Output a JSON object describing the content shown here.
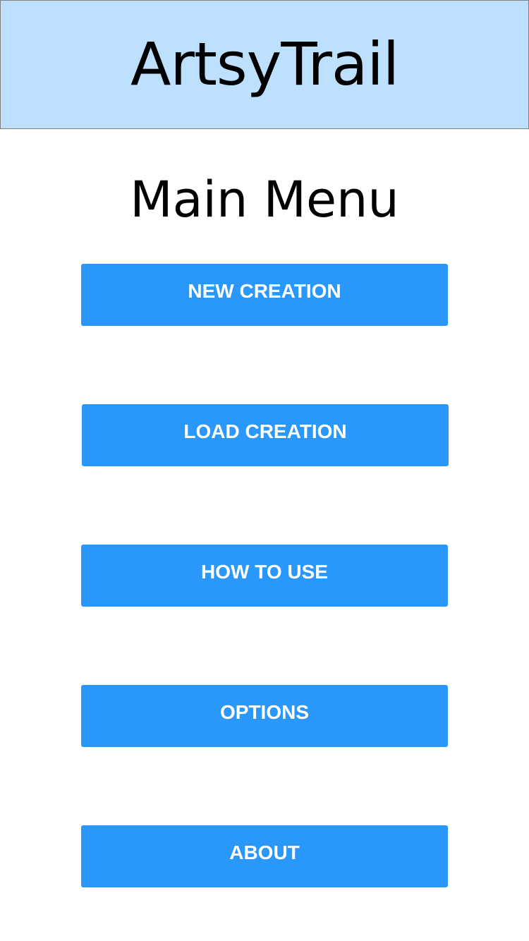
{
  "header": {
    "app_name": "ArtsyTrail",
    "background_color": "#bde0fe"
  },
  "main": {
    "title": "Main Menu",
    "buttons": [
      {
        "label": "NEW CREATION"
      },
      {
        "label": "LOAD CREATION"
      },
      {
        "label": "HOW TO USE"
      },
      {
        "label": "OPTIONS"
      },
      {
        "label": "ABOUT"
      }
    ],
    "button_color": "#2998fa"
  }
}
